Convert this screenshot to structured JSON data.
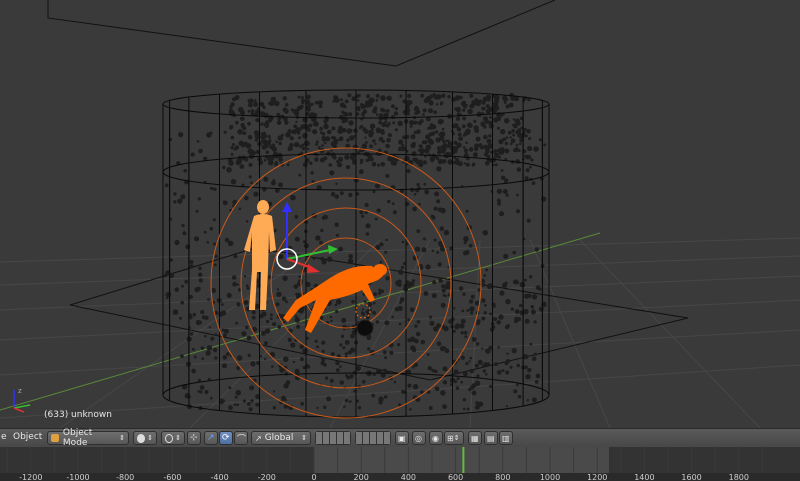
{
  "viewport": {
    "frame_label": "(633) unknown"
  },
  "header": {
    "object_menu": "Object",
    "mode": "Object Mode",
    "orientation": "Global"
  },
  "timeline": {
    "ticks": [
      "-1200",
      "-1000",
      "-800",
      "-600",
      "-400",
      "-200",
      "0",
      "200",
      "400",
      "600",
      "800",
      "1000",
      "1200",
      "1400",
      "1600",
      "1800"
    ],
    "current_frame": 633,
    "colors": {
      "range": "#4a4a4a",
      "cursor": "#5fbf3a"
    }
  },
  "colors": {
    "selected_orange": "#ff6a00",
    "light_orange": "#ffaa55",
    "wire": "#000000",
    "grid": "#4a4a4a"
  }
}
